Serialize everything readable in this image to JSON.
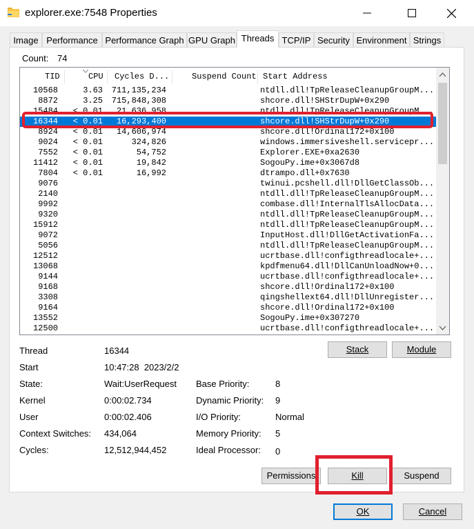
{
  "window": {
    "title": "explorer.exe:7548 Properties"
  },
  "tabs": [
    "Image",
    "Performance",
    "Performance Graph",
    "GPU Graph",
    "Threads",
    "TCP/IP",
    "Security",
    "Environment",
    "Strings"
  ],
  "active_tab": "Threads",
  "count": {
    "label": "Count:",
    "value": "74"
  },
  "columns": [
    "TID",
    "CPU",
    "Cycles D...",
    "Suspend Count",
    "Start Address"
  ],
  "rows": [
    {
      "tid": "10568",
      "cpu": "3.63",
      "cycles": "711,135,234",
      "addr": "ntdll.dll!TpReleaseCleanupGroupM..."
    },
    {
      "tid": "8872",
      "cpu": "3.25",
      "cycles": "715,848,308",
      "addr": "shcore.dll!SHStrDupW+0x290"
    },
    {
      "tid": "15484",
      "cpu": "< 0.01",
      "cycles": "21,636,958",
      "addr": "ntdll.dll!TpReleaseCleanupGroupM..."
    },
    {
      "tid": "16344",
      "cpu": "< 0.01",
      "cycles": "16,293,400",
      "addr": "shcore.dll!SHStrDupW+0x290",
      "selected": true
    },
    {
      "tid": "8924",
      "cpu": "< 0.01",
      "cycles": "14,606,974",
      "addr": "shcore.dll!Ordinal172+0x100"
    },
    {
      "tid": "9024",
      "cpu": "< 0.01",
      "cycles": "324,826",
      "addr": "windows.immersiveshell.servicepr..."
    },
    {
      "tid": "7552",
      "cpu": "< 0.01",
      "cycles": "54,752",
      "addr": "Explorer.EXE+0xa2630"
    },
    {
      "tid": "11412",
      "cpu": "< 0.01",
      "cycles": "19,842",
      "addr": "SogouPy.ime+0x3067d8"
    },
    {
      "tid": "7804",
      "cpu": "< 0.01",
      "cycles": "16,992",
      "addr": "dtrampo.dll+0x7630"
    },
    {
      "tid": "9076",
      "cpu": "",
      "cycles": "",
      "addr": "twinui.pcshell.dll!DllGetClassOb..."
    },
    {
      "tid": "2140",
      "cpu": "",
      "cycles": "",
      "addr": "ntdll.dll!TpReleaseCleanupGroupM..."
    },
    {
      "tid": "9992",
      "cpu": "",
      "cycles": "",
      "addr": "combase.dll!InternalTlsAllocData..."
    },
    {
      "tid": "9320",
      "cpu": "",
      "cycles": "",
      "addr": "ntdll.dll!TpReleaseCleanupGroupM..."
    },
    {
      "tid": "15912",
      "cpu": "",
      "cycles": "",
      "addr": "ntdll.dll!TpReleaseCleanupGroupM..."
    },
    {
      "tid": "9072",
      "cpu": "",
      "cycles": "",
      "addr": "InputHost.dll!DllGetActivationFa..."
    },
    {
      "tid": "5056",
      "cpu": "",
      "cycles": "",
      "addr": "ntdll.dll!TpReleaseCleanupGroupM..."
    },
    {
      "tid": "12512",
      "cpu": "",
      "cycles": "",
      "addr": "ucrtbase.dll!configthreadlocale+..."
    },
    {
      "tid": "13068",
      "cpu": "",
      "cycles": "",
      "addr": "kpdfmenu64.dll!DllCanUnloadNow+0..."
    },
    {
      "tid": "9144",
      "cpu": "",
      "cycles": "",
      "addr": "ucrtbase.dll!configthreadlocale+..."
    },
    {
      "tid": "9168",
      "cpu": "",
      "cycles": "",
      "addr": "shcore.dll!Ordinal172+0x100"
    },
    {
      "tid": "3308",
      "cpu": "",
      "cycles": "",
      "addr": "qingshellext64.dll!DllUnregister..."
    },
    {
      "tid": "9164",
      "cpu": "",
      "cycles": "",
      "addr": "shcore.dll!Ordinal172+0x100"
    },
    {
      "tid": "13552",
      "cpu": "",
      "cycles": "",
      "addr": "SogouPy.ime+0x307270"
    },
    {
      "tid": "12500",
      "cpu": "",
      "cycles": "",
      "addr": "ucrtbase.dll!configthreadlocale+..."
    }
  ],
  "details": {
    "thread_label": "Thread",
    "thread": "16344",
    "start_label": "Start",
    "start": "10:47:28  2023/2/2",
    "state_label": "State:",
    "state": "Wait:UserRequest",
    "kernel_label": "Kernel",
    "kernel": "0:00:02.734",
    "user_label": "User",
    "user": "0:00:02.406",
    "ctx_label": "Context Switches:",
    "ctx": "434,064",
    "cycles_label": "Cycles:",
    "cycles": "12,512,944,452",
    "base_prio_label": "Base Priority:",
    "base_prio": "8",
    "dyn_prio_label": "Dynamic Priority:",
    "dyn_prio": "9",
    "io_prio_label": "I/O Priority:",
    "io_prio": "Normal",
    "mem_prio_label": "Memory Priority:",
    "mem_prio": "5",
    "ideal_proc_label": "Ideal Processor:",
    "ideal_proc": "0"
  },
  "buttons": {
    "stack": "Stack",
    "module": "Module",
    "permissions": "Permissions",
    "kill": "Kill",
    "suspend": "Suspend",
    "ok": "OK",
    "cancel": "Cancel"
  }
}
